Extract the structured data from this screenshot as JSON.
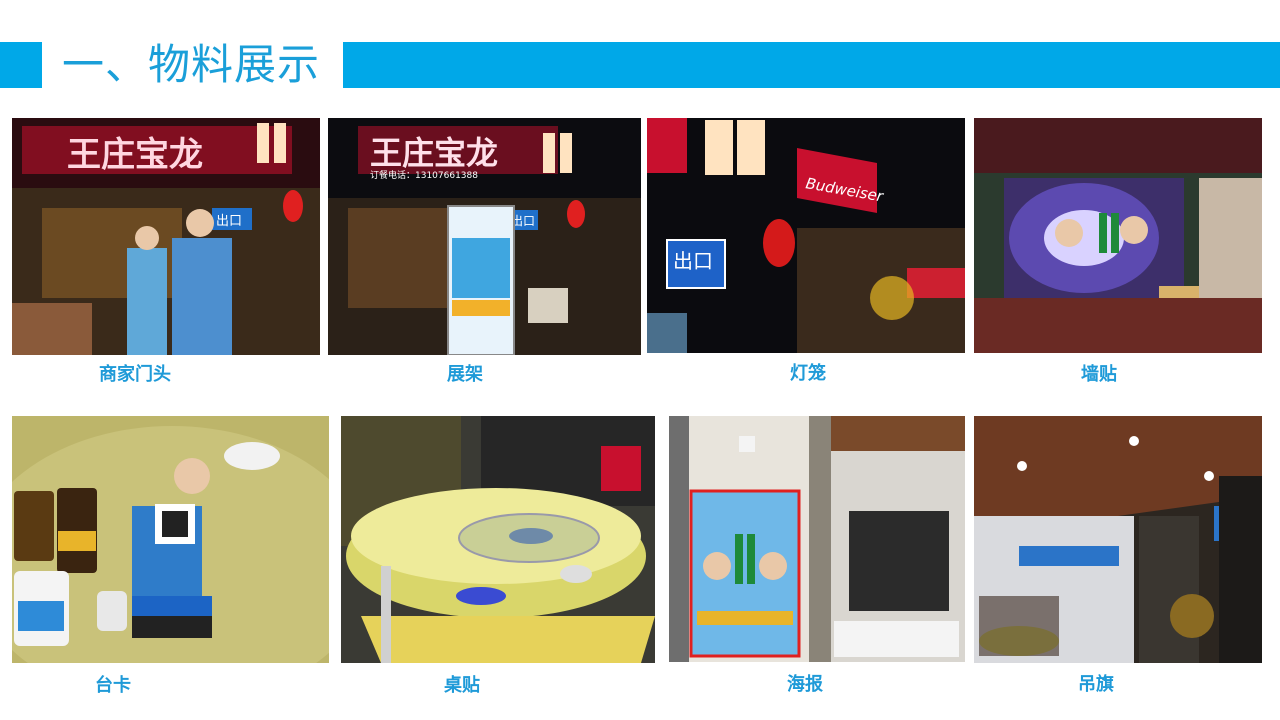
{
  "slide": {
    "title": "一、物料展示"
  },
  "photos": [
    {
      "caption": "商家门头",
      "sign": "王庄宝龙",
      "exit_sign": "出口"
    },
    {
      "caption": "展架",
      "sign": "王庄宝龙",
      "phone_label": "订餐电话：13107661388",
      "exit_sign": "出口"
    },
    {
      "caption": "灯笼",
      "brand_sign": "Budweiser",
      "exit_sign": "出口"
    },
    {
      "caption": "墙贴"
    },
    {
      "caption": "台卡"
    },
    {
      "caption": "桌贴"
    },
    {
      "caption": "海报"
    },
    {
      "caption": "吊旗"
    }
  ],
  "colors": {
    "accent_bar": "#00a8e8",
    "title_text": "#1a9fd9",
    "caption_text": "#1f9ad8"
  }
}
